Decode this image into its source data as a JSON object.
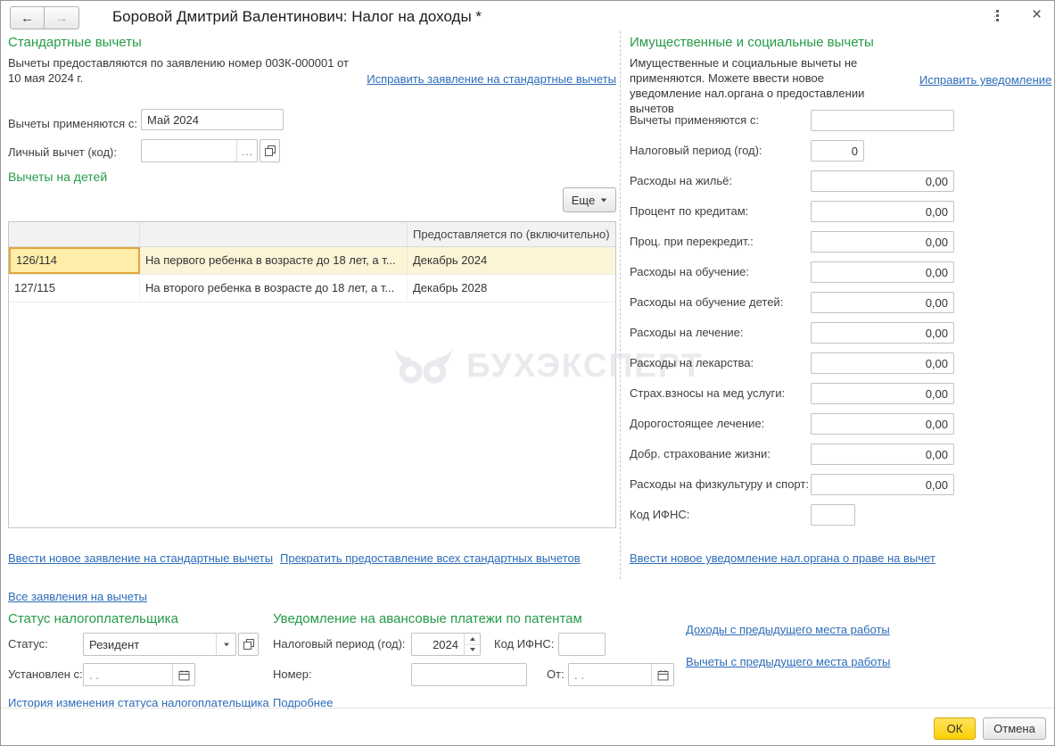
{
  "window": {
    "title": "Боровой Дмитрий Валентинович: Налог на доходы *",
    "icons": {
      "back": "←",
      "forward": "→",
      "close": "×",
      "ellipsis": "…"
    }
  },
  "standard": {
    "heading": "Стандартные вычеты",
    "statement_text": "Вычеты предоставляются по заявлению номер 003К-000001 от 10 мая 2024 г.",
    "fix_statement_link": "Исправить заявление на стандартные вычеты",
    "applied_from_label": "Вычеты применяются с:",
    "applied_from_value": "Май 2024",
    "personal_code_label": "Личный вычет (код):",
    "personal_code_value": "",
    "children_heading": "Вычеты на детей",
    "more_button": "Еще",
    "table": {
      "col3_header": "Предоставляется по (включительно)",
      "rows": [
        {
          "code": "126/114",
          "description": "На первого ребенка в возрасте до 18 лет, а т...",
          "until": "Декабрь 2024"
        },
        {
          "code": "127/115",
          "description": "На второго ребенка в возрасте до 18 лет, а т...",
          "until": "Декабрь 2028"
        }
      ]
    },
    "new_statement_link": "Ввести новое заявление на стандартные вычеты",
    "stop_all_link": "Прекратить предоставление всех стандартных вычетов",
    "all_statements_link": "Все заявления на вычеты"
  },
  "property_social": {
    "heading": "Имущественные и социальные вычеты",
    "description": "Имущественные и социальные вычеты не применяются. Можете ввести новое уведомление нал.органа о предоставлении вычетов",
    "fix_notification_link": "Исправить уведомление",
    "applied_from_label": "Вычеты применяются с:",
    "applied_from_value": "",
    "tax_period_label": "Налоговый период (год):",
    "tax_period_value": "0",
    "fields": [
      {
        "label": "Расходы на жильё:",
        "value": "0,00"
      },
      {
        "label": "Процент по кредитам:",
        "value": "0,00"
      },
      {
        "label": "Проц. при перекредит.:",
        "value": "0,00"
      },
      {
        "label": "Расходы на обучение:",
        "value": "0,00"
      },
      {
        "label": "Расходы на обучение детей:",
        "value": "0,00"
      },
      {
        "label": "Расходы на лечение:",
        "value": "0,00"
      },
      {
        "label": "Расходы на лекарства:",
        "value": "0,00"
      },
      {
        "label": "Страх.взносы на мед услуги:",
        "value": "0,00"
      },
      {
        "label": "Дорогостоящее лечение:",
        "value": "0,00"
      },
      {
        "label": "Добр. страхование жизни:",
        "value": "0,00"
      },
      {
        "label": "Расходы на физкультуру и спорт:",
        "value": "0,00"
      }
    ],
    "ifns_label": "Код ИФНС:",
    "ifns_value": "",
    "new_notification_link": "Ввести новое уведомление нал.органа о праве на вычет"
  },
  "status_section": {
    "heading": "Статус налогоплательщика",
    "status_label": "Статус:",
    "status_value": "Резидент",
    "set_from_label": "Установлен с:",
    "set_from_placeholder": ". .",
    "history_link": "История изменения статуса налогоплательщика"
  },
  "patent_section": {
    "heading": "Уведомление на авансовые платежи по патентам",
    "period_label": "Налоговый период (год):",
    "period_value": "2024",
    "ifns_label": "Код ИФНС:",
    "ifns_value": "",
    "number_label": "Номер:",
    "number_value": "",
    "from_label": "От:",
    "from_placeholder": ". .",
    "details_link": "Подробнее"
  },
  "other_links": {
    "prev_income": "Доходы с предыдущего места работы",
    "prev_deductions": "Вычеты с предыдущего места работы"
  },
  "footer": {
    "ok": "ОК",
    "cancel": "Отмена"
  },
  "watermark": "БУХЭКСПЕРТ",
  "colors": {
    "heading_green": "#259b48",
    "link_blue": "#2d6cb8",
    "selection_border": "#e0a73c",
    "selection_cell_bg": "#ffeda9",
    "selection_row_bg": "#fbf4d7",
    "ok_button_yellow": "#fccf08"
  }
}
